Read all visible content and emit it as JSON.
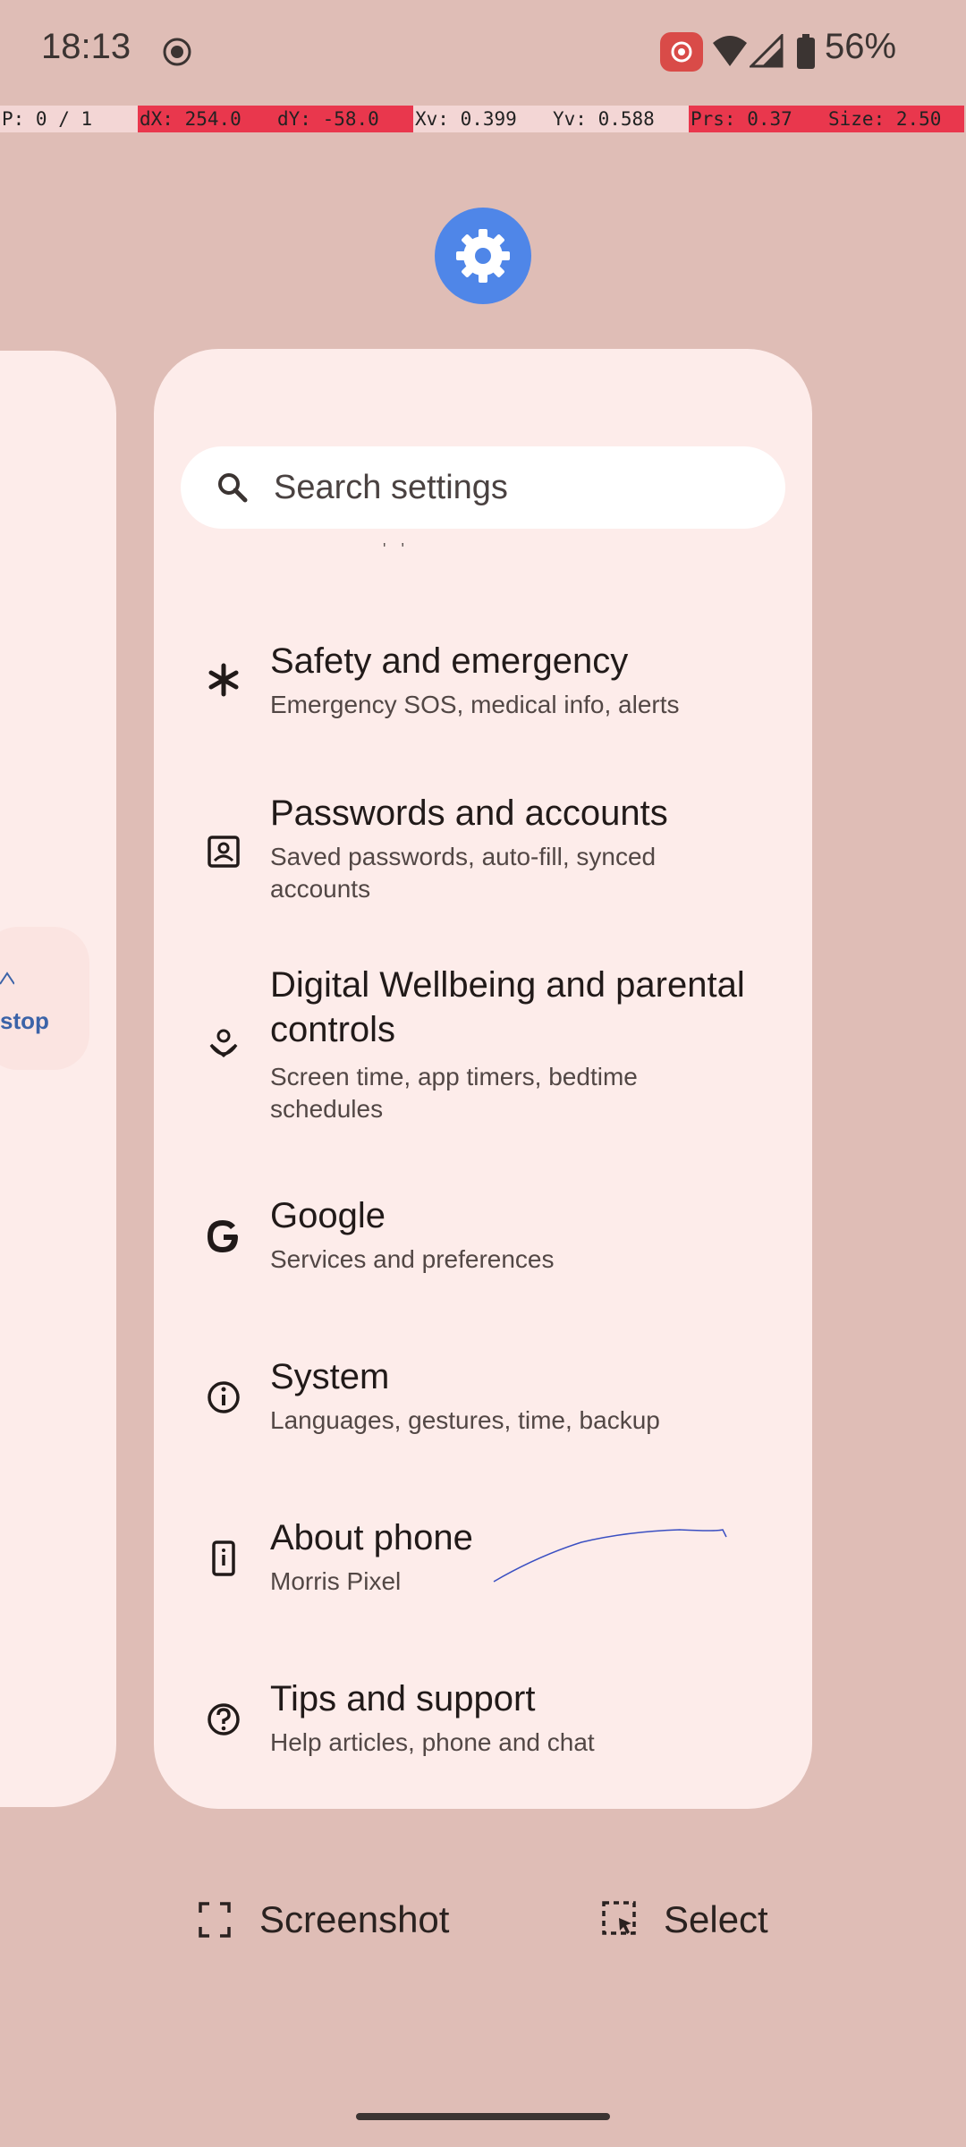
{
  "colors": {
    "background": "#dfbdb6",
    "card": "#fdecea",
    "accent_blue": "#4f86e8",
    "debug_red": "#e9374d"
  },
  "status_bar": {
    "time": "18:13",
    "battery": "56%",
    "icons": [
      "screen-record-icon",
      "cast-icon",
      "wifi-icon",
      "signal-icon",
      "battery-icon"
    ]
  },
  "debug_overlay": [
    "P: 0 / 1",
    "dX: 254.0",
    "dY: -58.0",
    "Xv: 0.399",
    "Yv: 0.588",
    "Prs: 0.37",
    "Size: 2.50"
  ],
  "left_card": {
    "chip_label": "stop"
  },
  "search": {
    "placeholder": "Search settings"
  },
  "tiny_text": "' '",
  "items": [
    {
      "icon": "asterisk-icon",
      "title": "Safety and emergency",
      "subtitle": "Emergency SOS, medical info, alerts"
    },
    {
      "icon": "account-box-icon",
      "title": "Passwords and accounts",
      "subtitle": "Saved passwords, auto-fill, synced accounts"
    },
    {
      "icon": "wellbeing-icon",
      "title": "Digital Wellbeing and parental controls",
      "subtitle": "Screen time, app timers, bedtime schedules"
    },
    {
      "icon": "google-icon",
      "title": "Google",
      "subtitle": "Services and preferences"
    },
    {
      "icon": "info-icon",
      "title": "System",
      "subtitle": "Languages, gestures, time, backup"
    },
    {
      "icon": "phone-info-icon",
      "title": "About phone",
      "subtitle": "Morris Pixel"
    },
    {
      "icon": "help-icon",
      "title": "Tips and support",
      "subtitle": "Help articles, phone and chat"
    }
  ],
  "actions": {
    "screenshot_label": "Screenshot",
    "select_label": "Select"
  }
}
